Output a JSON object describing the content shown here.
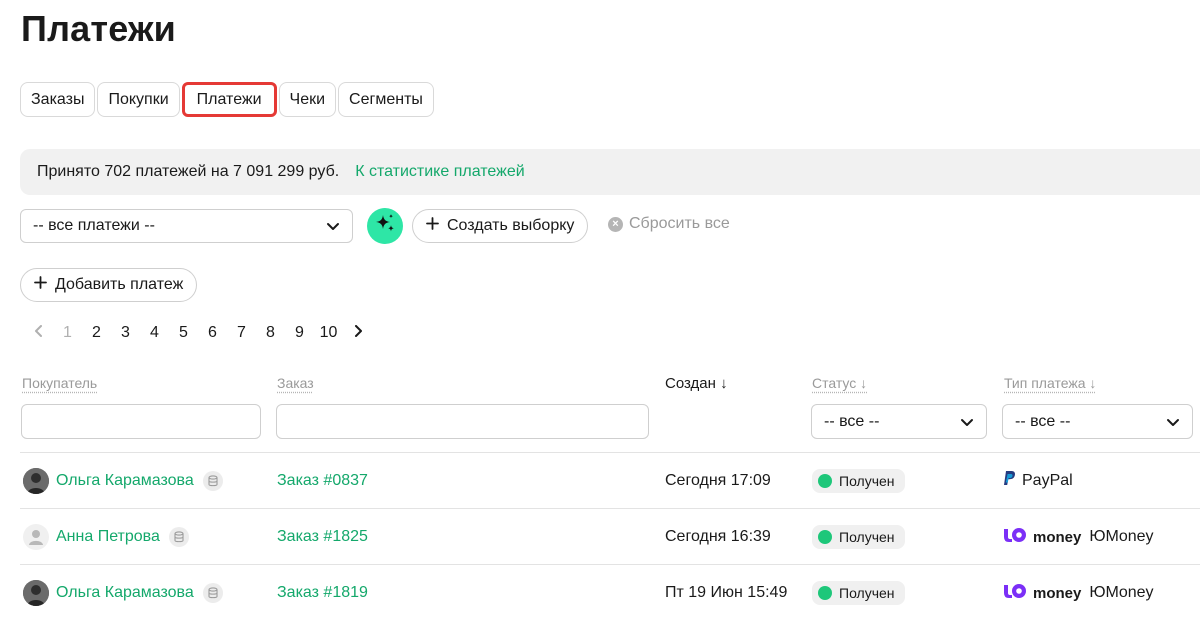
{
  "page": {
    "title": "Платежи"
  },
  "tabs": [
    {
      "label": "Заказы",
      "active": false
    },
    {
      "label": "Покупки",
      "active": false
    },
    {
      "label": "Платежи",
      "active": true
    },
    {
      "label": "Чеки",
      "active": false
    },
    {
      "label": "Сегменты",
      "active": false
    }
  ],
  "summary": {
    "text": "Принято 702 платежей на 7 091 299 руб.",
    "link": "К статистике платежей"
  },
  "filters": {
    "payments_select": "-- все платежи --",
    "create_selection": "Создать выборку",
    "reset_all": "Сбросить все",
    "add_payment": "Добавить платеж"
  },
  "pagination": {
    "pages": [
      "1",
      "2",
      "3",
      "4",
      "5",
      "6",
      "7",
      "8",
      "9",
      "10"
    ],
    "current": "1"
  },
  "columns": {
    "buyer": "Покупатель",
    "order": "Заказ",
    "created": "Создан ↓",
    "status": "Статус ↓",
    "payment_type": "Тип платежа ↓",
    "status_filter": "-- все --",
    "type_filter": "-- все --"
  },
  "rows": [
    {
      "buyer": "Ольга Карамазова",
      "avatar": "photo",
      "order": "Заказ #0837",
      "created": "Сегодня 17:09",
      "status": "Получен",
      "payment_type": "PayPal",
      "payment_logo": "paypal"
    },
    {
      "buyer": "Анна Петрова",
      "avatar": "ghost",
      "order": "Заказ #1825",
      "created": "Сегодня 16:39",
      "status": "Получен",
      "payment_type": "ЮMoney",
      "payment_logo": "yoomoney",
      "logo_word": "money"
    },
    {
      "buyer": "Ольга Карамазова",
      "avatar": "photo",
      "order": "Заказ #1819",
      "created": "Пт 19 Июн 15:49",
      "status": "Получен",
      "payment_type": "ЮMoney",
      "payment_logo": "yoomoney",
      "logo_word": "money"
    }
  ],
  "colors": {
    "accent": "#14a86b",
    "status_dot": "#1ec77a",
    "active_tab_border": "#e53935",
    "ai_button": "#2ee6a6",
    "yoomoney": "#7b2ff7"
  }
}
